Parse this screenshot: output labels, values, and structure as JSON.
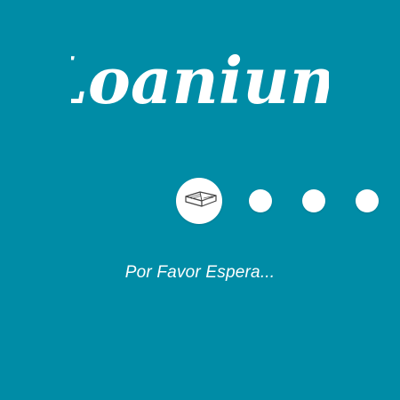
{
  "app": {
    "brand_name": "Loanium"
  },
  "loader": {
    "status_text": "Por Favor Espera...",
    "steps": [
      {
        "state": "active",
        "icon": "open-book-icon"
      },
      {
        "state": "pending"
      },
      {
        "state": "pending"
      },
      {
        "state": "pending"
      }
    ]
  },
  "colors": {
    "background": "#008ca6",
    "foreground": "#ffffff"
  }
}
